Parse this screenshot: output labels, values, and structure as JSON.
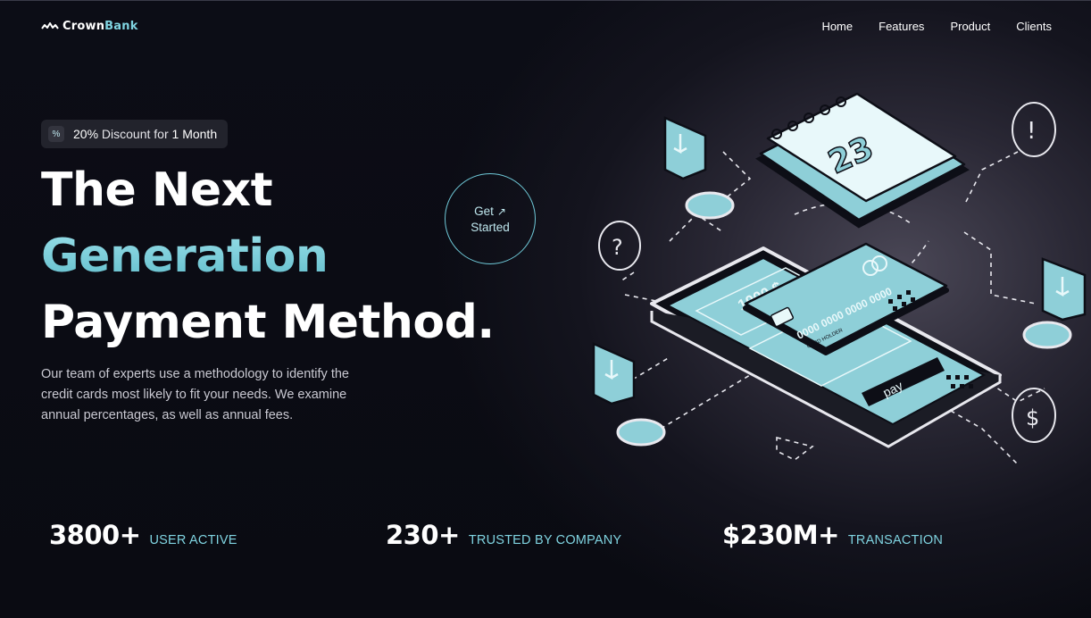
{
  "brand": {
    "name_main": "Crown",
    "name_accent": "Bank"
  },
  "nav": {
    "items": [
      "Home",
      "Features",
      "Product",
      "Clients"
    ]
  },
  "badge": {
    "icon": "percent-icon",
    "text_bold": "20%",
    "text_light": " Discount for ",
    "text_tail": "1 Month"
  },
  "hero": {
    "title_line1": "The Next",
    "title_line2": "Generation",
    "title_line3": "Payment Method.",
    "description": "Our team of experts use a methodology to identify the credit cards most likely to fit your needs. We examine annual percentages, as well as annual fees."
  },
  "cta": {
    "line1": "Get",
    "arrow": "↗",
    "line2": "Started"
  },
  "illustration": {
    "calendar_day": "23",
    "phone_amount": "1000 $",
    "card_number": "0000 0000 0000 0000",
    "card_holder": "CARD HOLDER",
    "pay_label": "pay",
    "question_mark": "?",
    "exclamation_mark": "!",
    "dollar_sign": "$"
  },
  "stats": [
    {
      "value": "3800+",
      "label": "USER ACTIVE"
    },
    {
      "value": "230+",
      "label": "TRUSTED BY COMPANY"
    },
    {
      "value": "$230M+",
      "label": "TRANSACTION"
    }
  ],
  "colors": {
    "accent": "#7fd3e0",
    "background": "#0b0c14",
    "illustration_fill": "#8ecfd8"
  }
}
